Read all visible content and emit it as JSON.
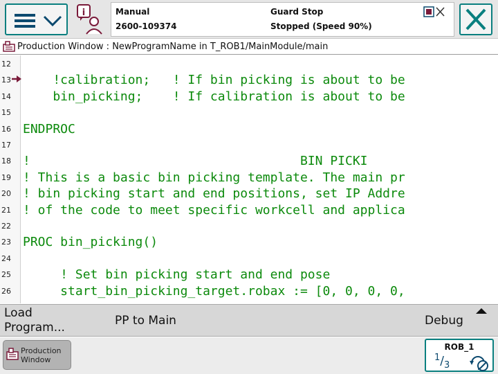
{
  "status": {
    "mode": "Manual",
    "serial": "2600-109374",
    "safety": "Guard Stop",
    "state": "Stopped (Speed 90%)"
  },
  "title_bar": {
    "text": "Production Window : NewProgramName in T_ROB1/MainModule/main"
  },
  "editor": {
    "lines": [
      {
        "n": "12",
        "code": ""
      },
      {
        "n": "13",
        "code": "    !calibration;   ! If bin picking is about to be",
        "pp": true
      },
      {
        "n": "14",
        "code": "    bin_picking;    ! If calibration is about to be"
      },
      {
        "n": "15",
        "code": ""
      },
      {
        "n": "16",
        "code": "ENDPROC"
      },
      {
        "n": "17",
        "code": ""
      },
      {
        "n": "18",
        "code": "!                                    BIN PICKI"
      },
      {
        "n": "19",
        "code": "! This is a basic bin picking template. The main pr"
      },
      {
        "n": "20",
        "code": "! bin picking start and end positions, set IP Addre"
      },
      {
        "n": "21",
        "code": "! of the code to meet specific workcell and applica"
      },
      {
        "n": "22",
        "code": ""
      },
      {
        "n": "23",
        "code": "PROC bin_picking()"
      },
      {
        "n": "24",
        "code": ""
      },
      {
        "n": "25",
        "code": "     ! Set bin picking start and end pose"
      },
      {
        "n": "26",
        "code": "     start_bin_picking_target.robax := [0, 0, 0, 0,"
      }
    ]
  },
  "commands": {
    "load_line1": "Load",
    "load_line2": "Program...",
    "pp_to_main": "PP to Main",
    "debug": "Debug"
  },
  "taskbar": {
    "production_line1": "Production",
    "production_line2": "Window",
    "quickset_label": "ROB_1",
    "increment_num": "1",
    "increment_den": "3"
  },
  "icons": {
    "menu": "hamburger-menu-icon",
    "menu_chevron": "chevron-down-icon",
    "event": "event-log-icon",
    "close": "close-icon",
    "program_pointer": "program-pointer-arrow-icon",
    "production_window": "production-window-icon",
    "run_mode": "run-mode-icon"
  },
  "colors": {
    "accent": "#0a7f7f",
    "code_text": "#0c8a0c",
    "pointer": "#7a1a3a"
  }
}
